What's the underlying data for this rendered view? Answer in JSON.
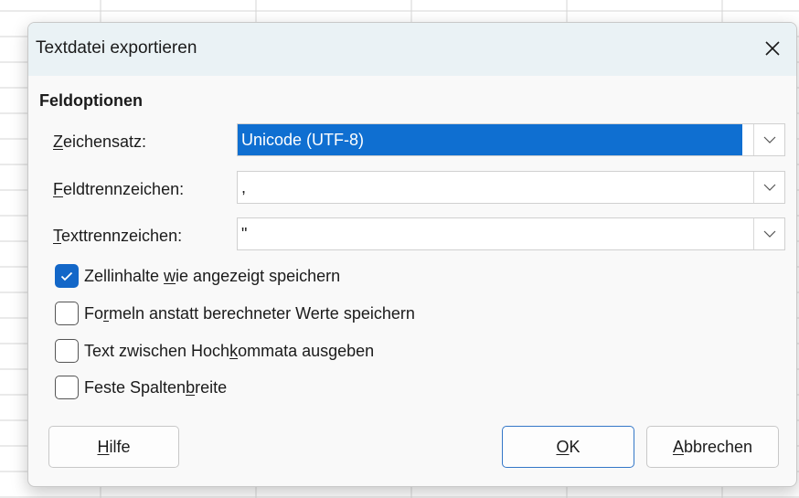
{
  "dialog": {
    "title": "Textdatei exportieren",
    "close_icon": "close-icon"
  },
  "section": {
    "title": "Feldoptionen"
  },
  "fields": {
    "charset": {
      "label_u": "Z",
      "label_rest": "eichensatz:",
      "value": "Unicode (UTF-8)"
    },
    "field_sep": {
      "label_u": "F",
      "label_rest": "eldtrennzeichen:",
      "value": ","
    },
    "text_sep": {
      "label_u": "T",
      "label_rest": "exttrennzeichen:",
      "value": "\""
    }
  },
  "options": [
    {
      "pre": "Zellinhalte ",
      "u": "w",
      "post": "ie angezeigt speichern",
      "checked": true
    },
    {
      "pre": "Fo",
      "u": "r",
      "post": "meln anstatt berechneter Werte speichern",
      "checked": false
    },
    {
      "pre": "Text zwischen Hoch",
      "u": "k",
      "post": "ommata ausgeben",
      "checked": false
    },
    {
      "pre": "Feste Spalten",
      "u": "b",
      "post": "reite",
      "checked": false
    }
  ],
  "buttons": {
    "help": {
      "u": "H",
      "rest": "ilfe"
    },
    "ok": {
      "u": "O",
      "rest": "K"
    },
    "cancel": {
      "u": "A",
      "rest": "bbrechen"
    }
  },
  "colors": {
    "accent": "#0f6fd1",
    "titlebar": "#eaf2f5"
  }
}
